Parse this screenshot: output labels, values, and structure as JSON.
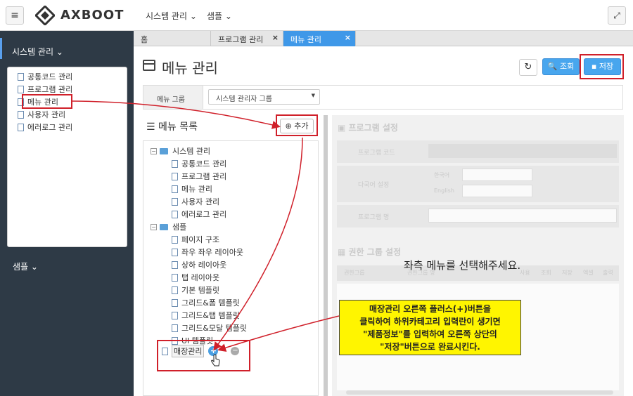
{
  "app": {
    "logo_text": "AXBOOT"
  },
  "topnav": [
    {
      "label": "시스템 관리 ⌄"
    },
    {
      "label": "샘플 ⌄"
    }
  ],
  "sidebar": {
    "section_label": "시스템 관리 ⌄",
    "items": [
      {
        "label": "공통코드 관리"
      },
      {
        "label": "프로그램 관리"
      },
      {
        "label": "메뉴 관리"
      },
      {
        "label": "사용자 관리"
      },
      {
        "label": "에러로그 관리"
      }
    ],
    "sample_label": "샘플 ⌄"
  },
  "tabs": [
    {
      "label": "홈"
    },
    {
      "label": "프로그램 관리",
      "close": "×"
    },
    {
      "label": "메뉴 관리",
      "close": "×"
    }
  ],
  "page": {
    "title": "메뉴 관리",
    "refresh_label": "↻",
    "search_button": "조회",
    "save_button": "저장"
  },
  "filter": {
    "label": "메뉴 그룹",
    "value": "시스템 관리자 그룹",
    "arrow": "▼"
  },
  "menu_list": {
    "title": "메뉴 목록",
    "add_button": "추가",
    "tree": {
      "group1": {
        "label": "시스템 관리",
        "toggle": "−",
        "children": [
          "공통코드 관리",
          "프로그램 관리",
          "메뉴 관리",
          "사용자 관리",
          "에러로그 관리"
        ]
      },
      "group2": {
        "label": "샘플",
        "toggle": "−",
        "children": [
          "페이지 구조",
          "좌우 좌우 레이아웃",
          "상하 레이아웃",
          "탭 레이아웃",
          "기본 템플릿",
          "그리드&폼 템플릿",
          "그리드&탭 템플릿",
          "그리드&모달 템플릿",
          "UI 템플릿"
        ]
      },
      "new_item": {
        "label": "매장관리",
        "plus": "+",
        "minus": "−"
      }
    }
  },
  "right_panel": {
    "title": "프로그램 설정",
    "program_code": "프로그램 코드",
    "multilang": "다국어 설정",
    "korean": "한국어",
    "english": "English",
    "program_name": "프로그램 명",
    "auth_title": "권한 그룹 설정",
    "col_auth": "권한그룹",
    "col_name": "권한그룹 명",
    "col_use": "사용",
    "col_read": "조회",
    "col_save": "저장",
    "col_excel": "엑셀",
    "col_print": "출력",
    "message": "좌측 메뉴를 선택해주세요."
  },
  "callout": {
    "line1": "매장관리 오른쪽 플러스(+)버튼을",
    "line2": "클릭하여 하위카테고리 입력란이 생기면",
    "line3": "\"제품정보\"를 입력하여 오른쪽 상단의",
    "line4": "\"저장\"버튼으로 완료시킨다."
  },
  "colors": {
    "sidebar_bg": "#2e3a46",
    "accent_blue": "#3f98e8",
    "annotation_red": "#d0202a",
    "callout_yellow": "#fff500"
  }
}
